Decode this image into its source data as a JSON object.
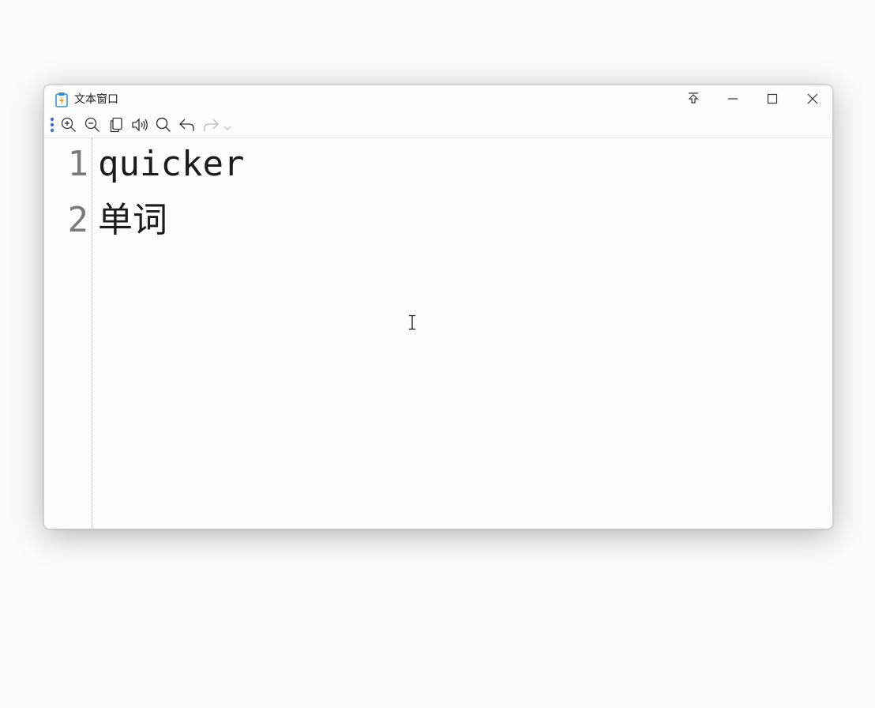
{
  "window": {
    "title": "文本窗口",
    "controls": [
      "pin-top-icon",
      "minimize-icon",
      "maximize-icon",
      "close-icon"
    ]
  },
  "toolbar": {
    "buttons": [
      "more-icon",
      "zoom-in-icon",
      "zoom-out-icon",
      "copy-icon",
      "speaker-icon",
      "search-icon",
      "undo-icon",
      "redo-icon",
      "dropdown-chevron-icon"
    ]
  },
  "editor": {
    "lines": [
      {
        "number": "1",
        "text": "quicker"
      },
      {
        "number": "2",
        "text": "单词"
      }
    ]
  },
  "colors": {
    "accent": "#3a6fd8",
    "text": "#1b1b1b",
    "line_number": "#7a7a7a"
  }
}
